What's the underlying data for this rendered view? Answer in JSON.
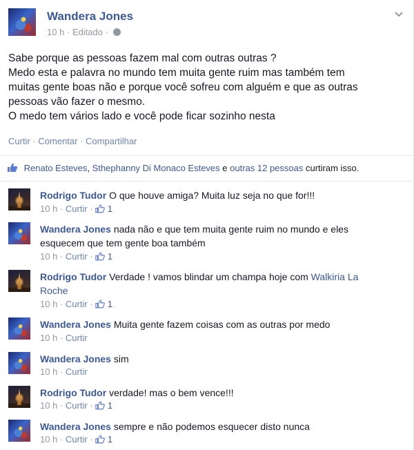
{
  "post": {
    "author": "Wandera Jones",
    "time": "10 h",
    "edited": "Editado",
    "separator": "·",
    "body_lines": [
      "Sabe porque as pessoas fazem mal com outras outras ?",
      "Medo esta e palavra no mundo tem muita gente ruim mas também tem",
      "muitas gente boas não e porque você sofreu com alguém e que as outras",
      "pessoas vão fazer o mesmo.",
      "O medo tem vários lado e você pode ficar sozinho nesta"
    ],
    "actions": {
      "like": "Curtir",
      "comment": "Comentar",
      "share": "Compartilhar"
    },
    "likes": {
      "person1": "Renato Esteves",
      "sep1": ",",
      "person2": "Sthephanny Di Monaco Esteves",
      "conj": "e",
      "others": "outras 12 pessoas",
      "suffix": "curtiram isso."
    }
  },
  "comments": [
    {
      "author": "Rodrigo Tudor",
      "text": "O que houve amiga? Muita luz seja no que for!!!",
      "time": "10 h",
      "reply": "Curtir",
      "likes": "1",
      "avatar": "rodrigo"
    },
    {
      "author": "Wandera Jones",
      "text": "nada não e que tem muita gente ruim no mundo e eles",
      "text2": "esquecem que tem gente boa também",
      "time": "10 h",
      "reply": "Curtir",
      "likes": "1",
      "avatar": "wandera"
    },
    {
      "author": "Rodrigo Tudor",
      "text": "Verdade ! vamos blindar um champa hoje com",
      "mention": "Walkiria La",
      "mention2": "Roche",
      "time": "10 h",
      "reply": "Curtir",
      "likes": "1",
      "avatar": "rodrigo"
    },
    {
      "author": "Wandera Jones",
      "text": "Muita gente fazem coisas com as outras por medo",
      "time": "10 h",
      "reply": "Curtir",
      "avatar": "wandera"
    },
    {
      "author": "Wandera Jones",
      "text": "sim",
      "time": "10 h",
      "reply": "Curtir",
      "avatar": "wandera"
    },
    {
      "author": "Rodrigo Tudor",
      "text": "verdade! mas o bem vence!!!",
      "time": "10 h",
      "reply": "Curtir",
      "likes": "1",
      "avatar": "rodrigo"
    },
    {
      "author": "Wandera Jones",
      "text": "sempre e não podemos esquecer disto nunca",
      "time": "10 h",
      "reply": "Curtir",
      "likes": "1",
      "avatar": "wandera"
    }
  ],
  "icons": {
    "thumb": "thumbs-up-icon",
    "globe": "globe-icon",
    "chevron": "chevron-down-icon"
  },
  "colors": {
    "link": "#3b5998",
    "muted": "#9197a3",
    "text": "#141823"
  }
}
